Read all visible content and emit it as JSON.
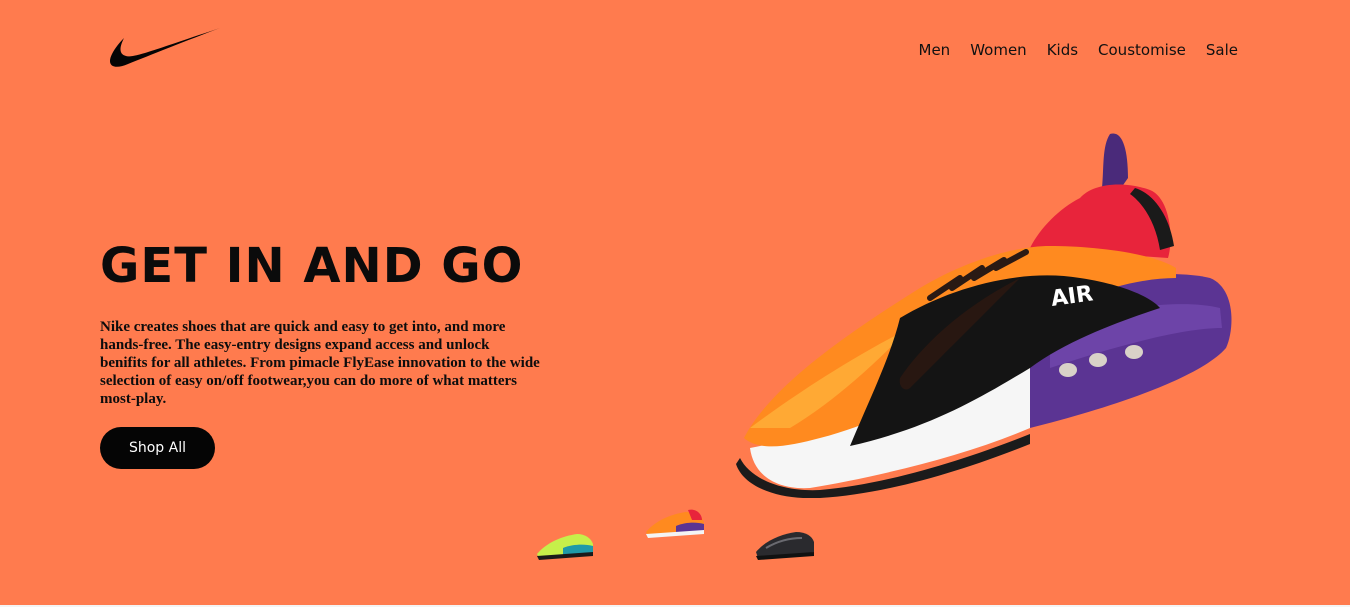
{
  "brand": {
    "logo_icon": "nike-swoosh-icon"
  },
  "nav": {
    "items": [
      {
        "label": "Men"
      },
      {
        "label": "Women"
      },
      {
        "label": "Kids"
      },
      {
        "label": "Coustomise"
      },
      {
        "label": "Sale"
      }
    ]
  },
  "hero": {
    "title": "GET IN AND GO",
    "description": "Nike creates shoes that are quick and easy to get into, and more hands-free. The easy-entry designs expand access and unlock benifits for all athletes. From pimacle FlyEase innovation to the wide selection of easy on/off footwear,you can do more of what matters most-play.",
    "cta_label": "Shop All"
  },
  "thumbnails": [
    {
      "name": "volt-teal-shoe",
      "active": false
    },
    {
      "name": "orange-purple-shoe",
      "active": true
    },
    {
      "name": "black-grey-shoe",
      "active": false
    }
  ],
  "colors": {
    "background": "#ff7b4e",
    "text": "#0b0b0b",
    "button_bg": "#050505",
    "button_text": "#ffffff"
  }
}
